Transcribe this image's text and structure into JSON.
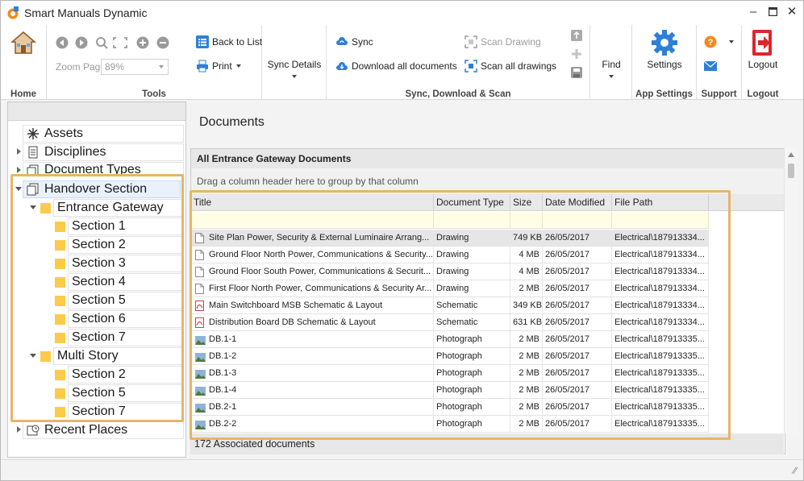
{
  "app": {
    "title": "Smart Manuals Dynamic"
  },
  "ribbon": {
    "home": {
      "label": "Home"
    },
    "tools": {
      "label": "Tools",
      "zoom_label": "Zoom Page",
      "zoom_value": "89%",
      "back_to_list": "Back to List",
      "print": "Print"
    },
    "sync_details": {
      "label": "Sync Details"
    },
    "sync_group": {
      "label": "Sync, Download & Scan",
      "sync": "Sync",
      "download_all": "Download all documents",
      "scan_drawing": "Scan Drawing",
      "scan_all": "Scan all drawings"
    },
    "find": {
      "label": "Find"
    },
    "app_settings": {
      "label": "App Settings",
      "settings": "Settings"
    },
    "support": {
      "label": "Support"
    },
    "logout": {
      "label": "Logout",
      "button": "Logout"
    }
  },
  "nav": {
    "assets": "Assets",
    "disciplines": "Disciplines",
    "document_types": "Document Types",
    "handover_section": "Handover Section",
    "entrance_gateway": "Entrance Gateway",
    "entrance_sections": [
      "Section 1",
      "Section 2",
      "Section 3",
      "Section 4",
      "Section 5",
      "Section 6",
      "Section 7"
    ],
    "multi_story": "Multi Story",
    "multi_sections": [
      "Section 2",
      "Section 5",
      "Section 7"
    ],
    "recent_places": "Recent Places"
  },
  "main": {
    "title": "Documents",
    "grid_caption": "All Entrance Gateway Documents",
    "group_hint": "Drag a column header here to group by that column",
    "columns": [
      "Title",
      "Document Type",
      "Size",
      "Date Modified",
      "File Path"
    ],
    "rows": [
      {
        "title": "Site Plan Power, Security & External Luminaire Arrang...",
        "type": "Drawing",
        "size": "749 KB",
        "date": "26/05/2017",
        "path": "Electrical\\187913334...",
        "icon": "document-icon"
      },
      {
        "title": "Ground Floor North Power, Communications & Security...",
        "type": "Drawing",
        "size": "4 MB",
        "date": "26/05/2017",
        "path": "Electrical\\187913334...",
        "icon": "document-icon"
      },
      {
        "title": "Ground Floor South Power, Communications & Securit...",
        "type": "Drawing",
        "size": "4 MB",
        "date": "26/05/2017",
        "path": "Electrical\\187913334...",
        "icon": "document-icon"
      },
      {
        "title": "First Floor North Power, Communications & Security Ar...",
        "type": "Drawing",
        "size": "2 MB",
        "date": "26/05/2017",
        "path": "Electrical\\187913334...",
        "icon": "document-icon"
      },
      {
        "title": "Main Switchboard MSB Schematic & Layout",
        "type": "Schematic",
        "size": "349 KB",
        "date": "26/05/2017",
        "path": "Electrical\\187913334...",
        "icon": "pdf-icon"
      },
      {
        "title": "Distribution Board DB Schematic & Layout",
        "type": "Schematic",
        "size": "631 KB",
        "date": "26/05/2017",
        "path": "Electrical\\187913334...",
        "icon": "pdf-icon"
      },
      {
        "title": "DB.1-1",
        "type": "Photograph",
        "size": "2 MB",
        "date": "26/05/2017",
        "path": "Electrical\\187913335...",
        "icon": "photo-icon"
      },
      {
        "title": "DB.1-2",
        "type": "Photograph",
        "size": "2 MB",
        "date": "26/05/2017",
        "path": "Electrical\\187913335...",
        "icon": "photo-icon"
      },
      {
        "title": "DB.1-3",
        "type": "Photograph",
        "size": "2 MB",
        "date": "26/05/2017",
        "path": "Electrical\\187913335...",
        "icon": "photo-icon"
      },
      {
        "title": "DB.1-4",
        "type": "Photograph",
        "size": "2 MB",
        "date": "26/05/2017",
        "path": "Electrical\\187913335...",
        "icon": "photo-icon"
      },
      {
        "title": "DB.2-1",
        "type": "Photograph",
        "size": "2 MB",
        "date": "26/05/2017",
        "path": "Electrical\\187913335...",
        "icon": "photo-icon"
      },
      {
        "title": "DB.2-2",
        "type": "Photograph",
        "size": "2 MB",
        "date": "26/05/2017",
        "path": "Electrical\\187913335...",
        "icon": "photo-icon"
      }
    ],
    "footer": "172 Associated documents"
  },
  "colors": {
    "accent": "#2f7fd6",
    "highlight": "#e6b569",
    "folder": "#fccb4a",
    "logout_red": "#e0242b",
    "help_orange": "#f28a1f"
  }
}
